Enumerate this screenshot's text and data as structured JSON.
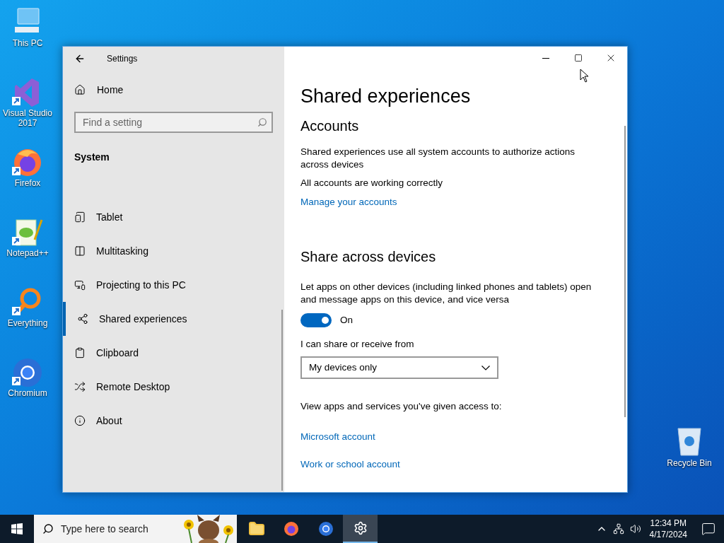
{
  "desktop_icons": [
    {
      "label": "This PC"
    },
    {
      "label": "Visual Studio 2017"
    },
    {
      "label": "Firefox"
    },
    {
      "label": "Notepad++"
    },
    {
      "label": "Everything"
    },
    {
      "label": "Chromium"
    }
  ],
  "recycle_bin": {
    "label": "Recycle Bin"
  },
  "window": {
    "title": "Settings",
    "home": "Home",
    "search": {
      "placeholder": "Find a setting"
    },
    "section": "System",
    "nav_items": [
      {
        "label": "Tablet",
        "selected": false
      },
      {
        "label": "Multitasking",
        "selected": false
      },
      {
        "label": "Projecting to this PC",
        "selected": false
      },
      {
        "label": "Shared experiences",
        "selected": true
      },
      {
        "label": "Clipboard",
        "selected": false
      },
      {
        "label": "Remote Desktop",
        "selected": false
      },
      {
        "label": "About",
        "selected": false
      }
    ],
    "page": {
      "heading": "Shared experiences",
      "accounts": {
        "heading": "Accounts",
        "description": "Shared experiences use all system accounts to authorize actions across devices",
        "status": "All accounts are working correctly",
        "link": "Manage your accounts"
      },
      "share": {
        "heading": "Share across devices",
        "description": "Let apps on other devices (including linked phones and tablets) open and message apps on this device, and vice versa",
        "toggle": {
          "on": true,
          "label": "On"
        },
        "dropdown_label": "I can share or receive from",
        "dropdown_value": "My devices only",
        "access_text": "View apps and services you've given access to:",
        "links": [
          "Microsoft account",
          "Work or school account"
        ]
      }
    }
  },
  "taskbar": {
    "search": {
      "placeholder": "Type here to search"
    },
    "apps": [
      {
        "selected": false
      },
      {
        "selected": false
      },
      {
        "selected": false
      },
      {
        "selected": true
      }
    ],
    "time": "12:34 PM",
    "date": "4/17/2024"
  }
}
